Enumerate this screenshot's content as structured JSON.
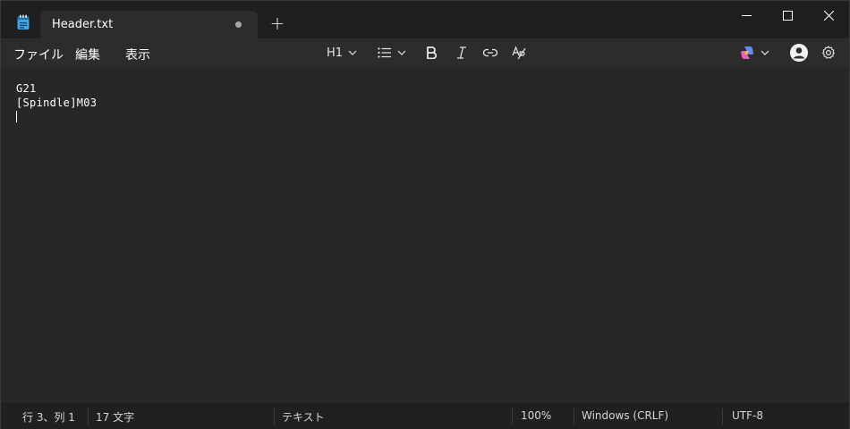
{
  "tab": {
    "title": "Header.txt"
  },
  "menu": {
    "file": "ファイル",
    "edit": "編集",
    "view": "表示"
  },
  "toolbar": {
    "heading": "H1"
  },
  "editor": {
    "lines": [
      "G21",
      "[Spindle]M03",
      ""
    ]
  },
  "status": {
    "position": "行 3、列 1",
    "chars": "17 文字",
    "format": "テキスト",
    "zoom": "100%",
    "line_ending": "Windows (CRLF)",
    "encoding": "UTF-8"
  },
  "icons": [
    "notepad-icon",
    "tab-modified-dot",
    "new-tab-icon",
    "minimize-icon",
    "maximize-icon",
    "close-icon",
    "chevron-down-icon",
    "bullet-list-icon",
    "bold-icon",
    "italic-icon",
    "link-icon",
    "clear-formatting-icon",
    "copilot-icon",
    "account-icon",
    "settings-icon"
  ],
  "colors": {
    "background": "#272727",
    "titlebar": "#1f1f1f",
    "statusbar": "#202020",
    "text": "#ffffff"
  }
}
